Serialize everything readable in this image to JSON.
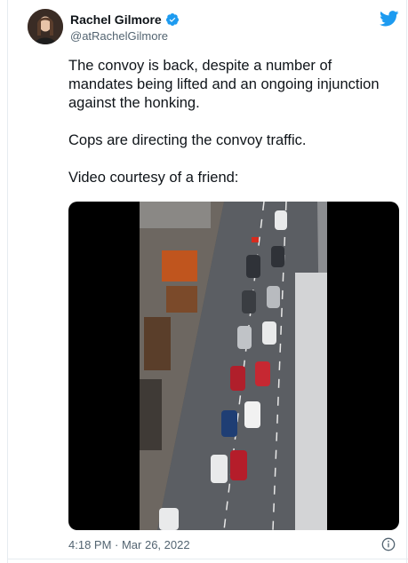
{
  "author": {
    "display_name": "Rachel Gilmore",
    "handle": "@atRachelGilmore"
  },
  "tweet": {
    "paragraphs": [
      "The convoy is back, despite a number of mandates being lifted and an ongoing injunction against the honking.",
      "Cops are directing the convoy traffic.",
      "Video courtesy of a friend:"
    ],
    "timestamp": "4:18 PM · Mar 26, 2022"
  },
  "icons": {
    "verified": "verified-badge-icon",
    "brand": "twitter-bird-icon",
    "info": "info-icon"
  },
  "colors": {
    "brand_blue": "#1d9bf0",
    "text": "#0f1419",
    "secondary_text": "#536471"
  }
}
